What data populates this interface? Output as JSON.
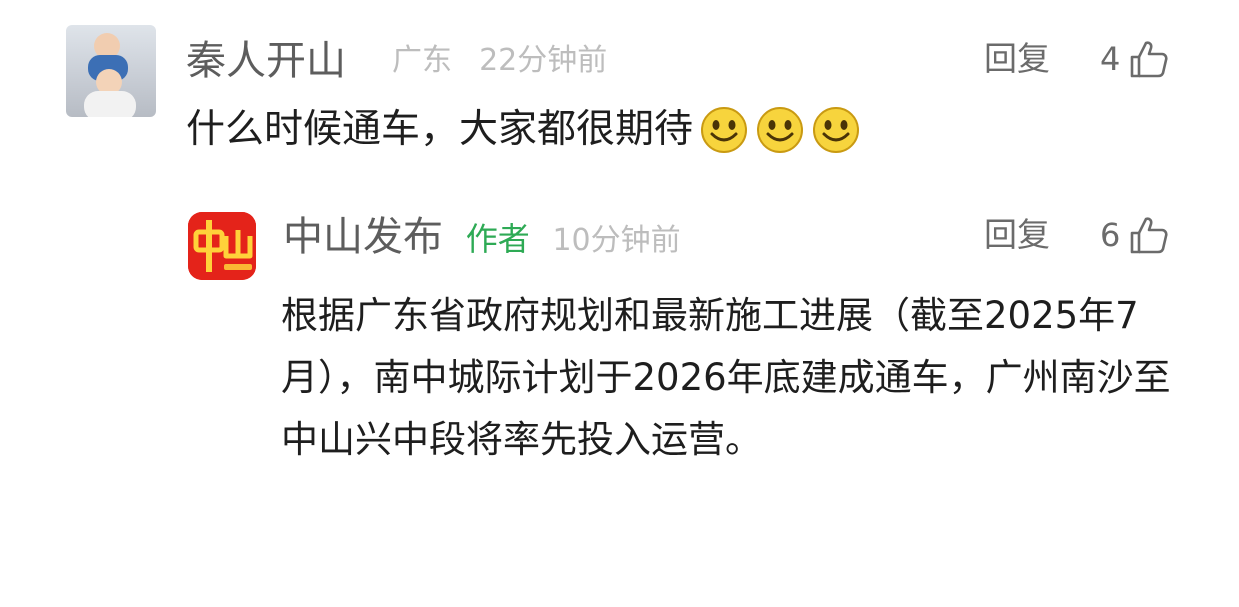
{
  "comment": {
    "username": "秦人开山",
    "location": "广东",
    "time": "22分钟前",
    "reply_label": "回复",
    "likes": "4",
    "text": "什么时候通车，大家都很期待",
    "emoji_count": 3
  },
  "reply": {
    "author": "中山发布",
    "author_badge": "作者",
    "time": "10分钟前",
    "reply_label": "回复",
    "likes": "6",
    "text": "根据广东省政府规划和最新施工进展（截至2025年7月），南中城际计划于2026年底建成通车，广州南沙至中山兴中段将率先投入运营。",
    "avatar_text": "中山"
  },
  "colors": {
    "author_badge": "#2eaa55",
    "avatar_red": "#e4231a",
    "avatar_yellow": "#ffd23a"
  }
}
